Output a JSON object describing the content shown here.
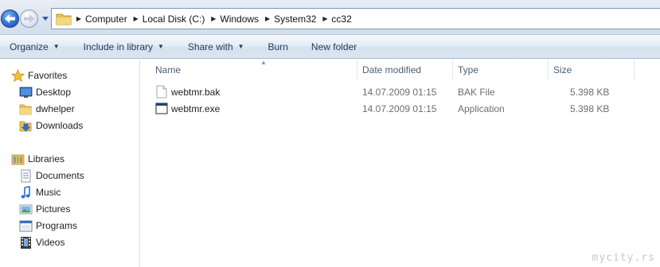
{
  "address": {
    "crumbs": [
      "Computer",
      "Local Disk (C:)",
      "Windows",
      "System32",
      "cc32"
    ]
  },
  "toolbar": {
    "organize": "Organize",
    "include_in_library": "Include in library",
    "share_with": "Share with",
    "burn": "Burn",
    "new_folder": "New folder"
  },
  "sidebar": {
    "favorites": {
      "label": "Favorites",
      "items": [
        {
          "label": "Desktop",
          "icon": "desktop-icon"
        },
        {
          "label": "dwhelper",
          "icon": "folder-icon"
        },
        {
          "label": "Downloads",
          "icon": "downloads-icon"
        }
      ]
    },
    "libraries": {
      "label": "Libraries",
      "items": [
        {
          "label": "Documents",
          "icon": "documents-icon"
        },
        {
          "label": "Music",
          "icon": "music-icon"
        },
        {
          "label": "Pictures",
          "icon": "pictures-icon"
        },
        {
          "label": "Programs",
          "icon": "programs-icon"
        },
        {
          "label": "Videos",
          "icon": "videos-icon"
        }
      ]
    }
  },
  "columns": {
    "name": "Name",
    "date_modified": "Date modified",
    "type": "Type",
    "size": "Size"
  },
  "files": [
    {
      "name": "webtmr.bak",
      "date": "14.07.2009 01:15",
      "type": "BAK File",
      "size": "5.398 KB",
      "icon": "generic-file-icon"
    },
    {
      "name": "webtmr.exe",
      "date": "14.07.2009 01:15",
      "type": "Application",
      "size": "5.398 KB",
      "icon": "application-icon"
    }
  ],
  "watermark": "mycity.rs",
  "colors": {
    "accent": "#1e395b",
    "header_text": "#4c607a",
    "meta_text": "#6d6d6d"
  }
}
